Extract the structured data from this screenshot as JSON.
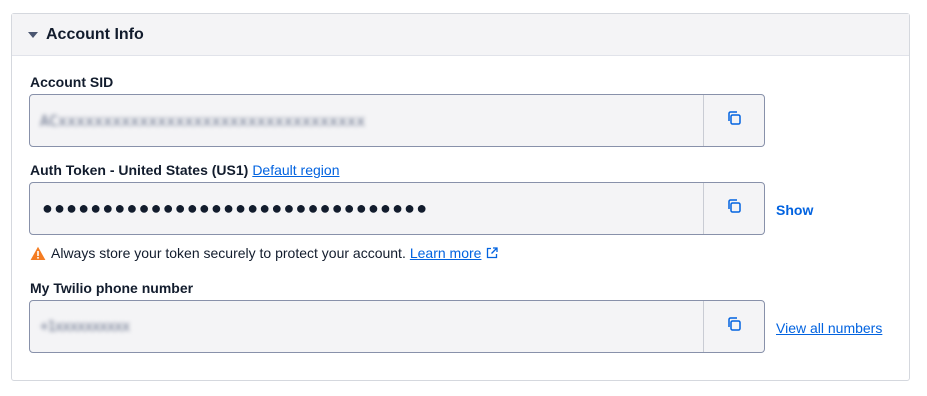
{
  "section": {
    "title": "Account Info",
    "caret_icon": "caret-down-icon"
  },
  "account_sid": {
    "label": "Account SID",
    "value": "ACxxxxxxxxxxxxxxxxxxxxxxxxxxxxxxxxxx",
    "copy_icon": "copy-icon"
  },
  "auth_token": {
    "label": "Auth Token - United States (US1)",
    "region_link": "Default region",
    "masked_value": "●●●●●●●●●●●●●●●●●●●●●●●●●●●●●●●●",
    "copy_icon": "copy-icon",
    "show_label": "Show"
  },
  "warning": {
    "icon": "warning-icon",
    "text": "Always store your token securely to protect your account.",
    "link": "Learn more",
    "link_icon": "external-link-icon"
  },
  "phone": {
    "label": "My Twilio phone number",
    "value": "+1xxxxxxxxxx",
    "copy_icon": "copy-icon",
    "view_all_label": "View all numbers"
  },
  "colors": {
    "link": "#0263e0",
    "header_bg": "#f4f4f6",
    "field_border": "#8891aa",
    "warning": "#f47c22"
  }
}
